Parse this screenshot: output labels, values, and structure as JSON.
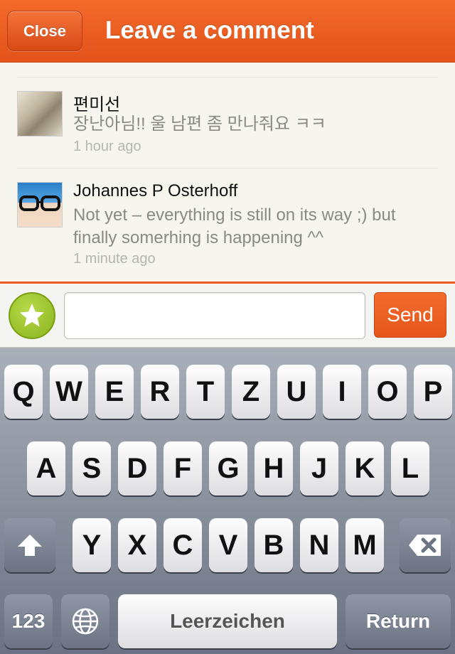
{
  "header": {
    "close_label": "Close",
    "title": "Leave a comment"
  },
  "comments": [
    {
      "author": "편미선",
      "text": "장난아님!! 울 남편 좀 만나줘요 ㅋㅋ",
      "time": "1 hour ago"
    },
    {
      "author": "Johannes P Osterhoff",
      "text": "Not yet – everything is still on its way ;) but finally somerhing is happening ^^",
      "time": "1 minute ago"
    }
  ],
  "composer": {
    "input_value": "",
    "send_label": "Send",
    "star_icon": "star-icon"
  },
  "keyboard": {
    "row1": [
      "Q",
      "W",
      "E",
      "R",
      "T",
      "Z",
      "U",
      "I",
      "O",
      "P"
    ],
    "row2": [
      "A",
      "S",
      "D",
      "F",
      "G",
      "H",
      "J",
      "K",
      "L"
    ],
    "row3": [
      "Y",
      "X",
      "C",
      "V",
      "B",
      "N",
      "M"
    ],
    "numbers_label": "123",
    "space_label": "Leerzeichen",
    "return_label": "Return"
  },
  "colors": {
    "header_orange": "#e85a1f",
    "accent_green": "#8ab41d",
    "keyboard_gray": "#8a919e"
  }
}
